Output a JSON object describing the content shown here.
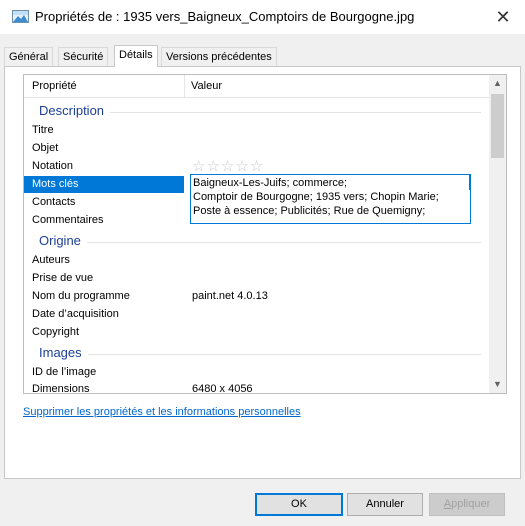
{
  "window": {
    "title": "Propriétés de : 1935 vers_Baigneux_Comptoirs de Bourgogne.jpg",
    "close_glyph": "✕"
  },
  "tabs": [
    {
      "label": "Général"
    },
    {
      "label": "Sécurité"
    },
    {
      "label": "Détails",
      "active": true
    },
    {
      "label": "Versions précédentes"
    }
  ],
  "list": {
    "header": {
      "property": "Propriété",
      "value": "Valeur"
    },
    "sections": {
      "description": "Description",
      "origine": "Origine",
      "images": "Images"
    },
    "rows": {
      "titre": {
        "k": "Titre",
        "v": ""
      },
      "objet": {
        "k": "Objet",
        "v": ""
      },
      "notation": {
        "k": "Notation",
        "stars": "☆☆☆☆☆",
        "rating": 0,
        "max": 5
      },
      "mots_cles": {
        "k": "Mots clés"
      },
      "contacts": {
        "k": "Contacts"
      },
      "commentaires": {
        "k": "Commentaires"
      },
      "auteurs": {
        "k": "Auteurs"
      },
      "prise_de_vue": {
        "k": "Prise de vue"
      },
      "programme": {
        "k": "Nom du programme",
        "v": "paint.net 4.0.13"
      },
      "date_acq": {
        "k": "Date d’acquisition"
      },
      "copyright": {
        "k": "Copyright"
      },
      "id_image": {
        "k": "ID de l’image"
      },
      "dimensions": {
        "k": "Dimensions",
        "v": "6480 x 4056"
      }
    },
    "keywords_edit": [
      "Baigneux-Les-Juifs; commerce;",
      "Comptoir de Bourgogne; 1935 vers; Chopin Marie;",
      "Poste à essence; Publicités; Rue de Quemigny;"
    ]
  },
  "scrollbar": {
    "up": "▲",
    "down": "▼"
  },
  "link": "Supprimer les propriétés et les informations personnelles",
  "buttons": {
    "ok": "OK",
    "cancel": "Annuler",
    "apply_first": "A",
    "apply_rest": "ppliquer"
  },
  "colors": {
    "accent": "#0078d7",
    "section": "#1c3f94",
    "link": "#0066cc"
  }
}
